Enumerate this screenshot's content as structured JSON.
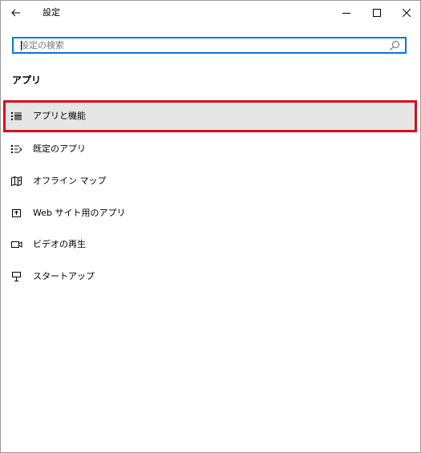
{
  "window": {
    "title": "設定"
  },
  "search": {
    "placeholder": "設定の検索",
    "value": ""
  },
  "section": {
    "heading": "アプリ"
  },
  "nav": {
    "items": [
      {
        "label": "アプリと機能",
        "icon": "apps-features-icon",
        "selected": true
      },
      {
        "label": "既定のアプリ",
        "icon": "default-apps-icon",
        "selected": false
      },
      {
        "label": "オフライン マップ",
        "icon": "offline-maps-icon",
        "selected": false
      },
      {
        "label": "Web サイト用のアプリ",
        "icon": "apps-for-websites-icon",
        "selected": false
      },
      {
        "label": "ビデオの再生",
        "icon": "video-playback-icon",
        "selected": false
      },
      {
        "label": "スタートアップ",
        "icon": "startup-icon",
        "selected": false
      }
    ]
  },
  "colors": {
    "accent": "#0078d7",
    "selection_highlight": "#d6101d",
    "selected_background": "#e6e6e6"
  }
}
